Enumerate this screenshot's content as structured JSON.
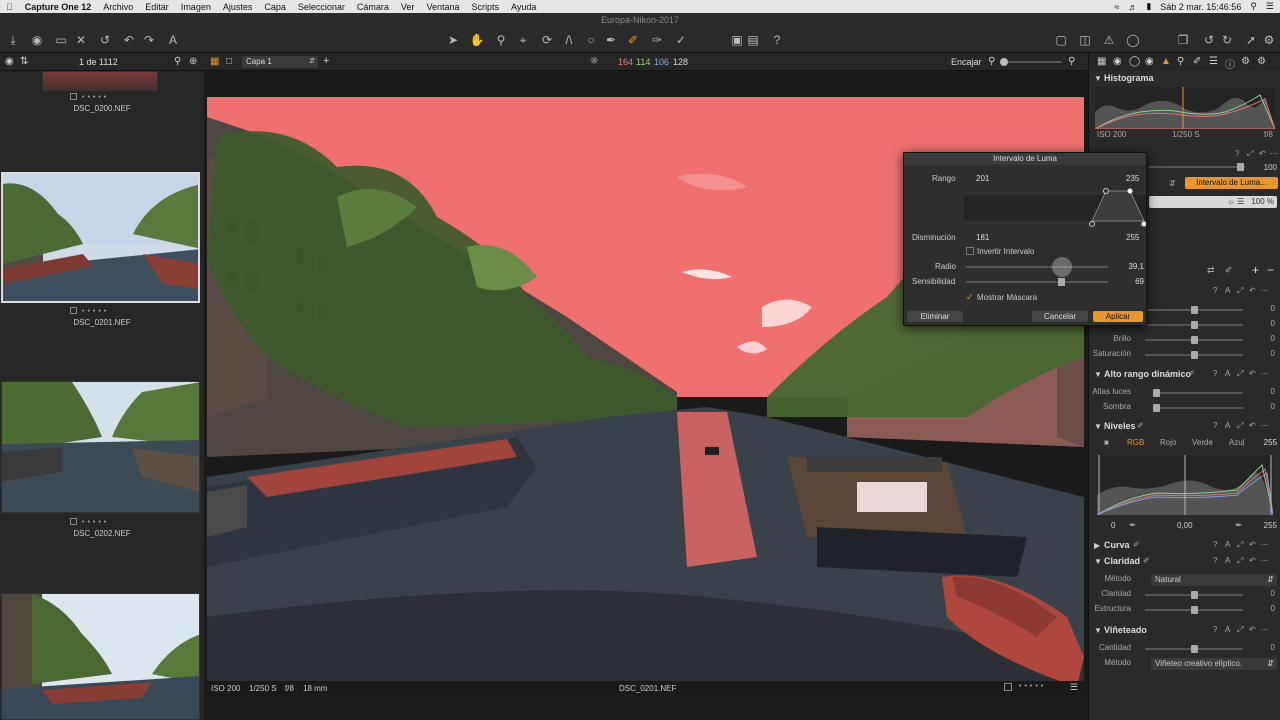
{
  "menubar": {
    "app": "Capture One 12",
    "items": [
      "Archivo",
      "Editar",
      "Imagen",
      "Ajustes",
      "Capa",
      "Seleccionar",
      "Cámara",
      "Ver",
      "Ventana",
      "Scripts",
      "Ayuda"
    ],
    "clock": "Sáb 2 mar.  15:46:56"
  },
  "window_title": "Europa-Nikon-2017",
  "viewerbar": {
    "counter": "1 de 1112",
    "layer": "Capa 1",
    "rgb": {
      "r": "164",
      "g": "114",
      "b": "106",
      "a": "128"
    },
    "fit": "Encajar"
  },
  "browser": {
    "thumbs": [
      {
        "name": "DSC_0200.NEF"
      },
      {
        "name": "DSC_0201.NEF"
      },
      {
        "name": "DSC_0202.NEF"
      }
    ]
  },
  "viewer_footer": {
    "iso": "ISO 200",
    "shutter": "1/250 S",
    "aperture": "f/8",
    "focal": "18 mm",
    "filename": "DSC_0201.NEF"
  },
  "luma_dialog": {
    "title": "Intervalo de Luma",
    "range_label": "Rango",
    "range_min": "201",
    "range_max": "235",
    "falloff_label": "Disminución",
    "falloff_min": "181",
    "falloff_max": "255",
    "invert_label": "Invertir Intervalo",
    "radius_label": "Radio",
    "radius_value": "39,1",
    "sensitivity_label": "Sensibilidad",
    "sensitivity_value": "69",
    "show_mask_label": "Mostrar Máscara",
    "delete": "Eliminar",
    "cancel": "Cancelar",
    "apply": "Aplicar"
  },
  "inspector": {
    "histogram_title": "Histograma",
    "hist_iso": "ISO 200",
    "hist_shutter": "1/250 S",
    "hist_aperture": "f/8",
    "opacity_value": "100",
    "luma_button": "Intervalo de Luma...",
    "mask_percent": "100 %",
    "color_rows": [
      {
        "label": "",
        "value": "0"
      },
      {
        "label": "",
        "value": "0"
      },
      {
        "label": "Brillo",
        "value": "0"
      },
      {
        "label": "Saturación",
        "value": "0"
      }
    ],
    "hdr_title": "Alto rango dinámico",
    "hdr_rows": [
      {
        "label": "Altas luces",
        "value": "0"
      },
      {
        "label": "Sombra",
        "value": "0"
      }
    ],
    "levels_title": "Niveles",
    "levels_tabs": [
      "RGB",
      "Rojo",
      "Verde",
      "Azul"
    ],
    "levels_top_right": "255",
    "levels_bottom": {
      "left": "0",
      "mid": "0,00",
      "right": "255"
    },
    "curve_title": "Curva",
    "clarity_title": "Claridad",
    "clarity_method_label": "Método",
    "clarity_method_value": "Natural",
    "clarity_rows": [
      {
        "label": "Claridad",
        "value": "0"
      },
      {
        "label": "Estructura",
        "value": "0"
      }
    ],
    "vignette_title": "Viñeteado",
    "vignette_rows": [
      {
        "label": "Cantidad",
        "value": "0"
      }
    ],
    "vignette_method_label": "Método",
    "vignette_method_value": "Viñeteo creativo elíptico."
  }
}
